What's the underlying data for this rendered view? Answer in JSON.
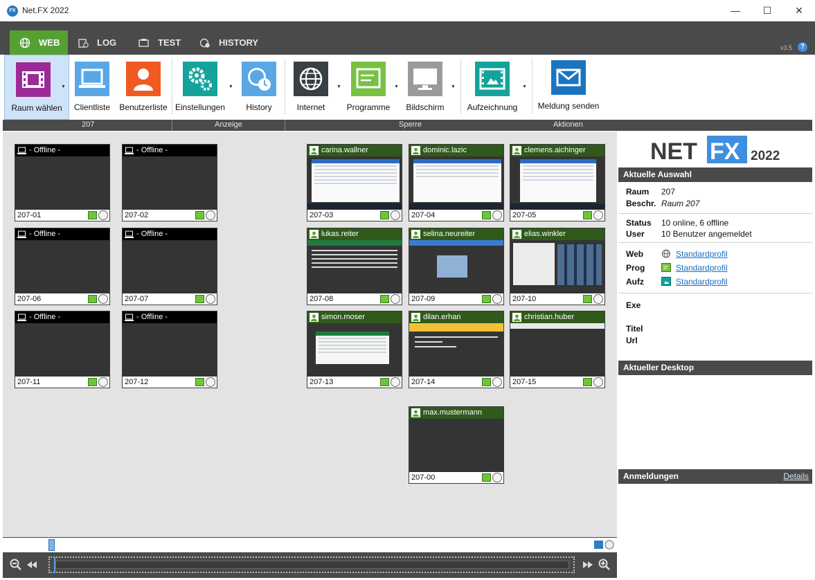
{
  "window": {
    "title": "Net.FX 2022",
    "app_icon": "FX",
    "minimize": "—",
    "maximize": "☐",
    "close": "✕"
  },
  "tabs": [
    {
      "label": "WEB",
      "icon": "globe-icon",
      "active": true
    },
    {
      "label": "LOG",
      "icon": "log-icon",
      "active": false
    },
    {
      "label": "TEST",
      "icon": "test-icon",
      "active": false
    },
    {
      "label": "HISTORY",
      "icon": "history-icon",
      "active": false
    }
  ],
  "version": "v3.5",
  "help": "?",
  "ribbon": {
    "buttons": [
      {
        "label": "Raum wählen",
        "icon": "film-strip-icon",
        "color": "#9b2a98",
        "dropdown": true,
        "selected": true
      },
      {
        "label": "Clientliste",
        "icon": "laptop-icon",
        "color": "#5aa7e6",
        "dropdown": false
      },
      {
        "label": "Benutzerliste",
        "icon": "user-icon",
        "color": "#f0591f",
        "dropdown": false
      },
      {
        "label": "Einstellungen",
        "icon": "gears-icon",
        "color": "#13a39b",
        "dropdown": true
      },
      {
        "label": "History",
        "icon": "clock-globe-icon",
        "color": "#5aa7e6",
        "dropdown": false
      },
      {
        "label": "Internet",
        "icon": "globe-icon",
        "color": "#3a3f43",
        "dropdown": true
      },
      {
        "label": "Programme",
        "icon": "program-icon",
        "color": "#79c142",
        "dropdown": true
      },
      {
        "label": "Bildschirm",
        "icon": "monitor-icon",
        "color": "#9a9a9a",
        "dropdown": true
      },
      {
        "label": "Aufzeichnung",
        "icon": "recording-icon",
        "color": "#13a39b",
        "dropdown": true
      },
      {
        "label": "Meldung senden",
        "icon": "envelope-icon",
        "color": "#1b74c0",
        "dropdown": false
      }
    ],
    "groups": {
      "room": "207",
      "view": "Anzeige",
      "lock": "Sperre",
      "actions": "Aktionen"
    }
  },
  "clients": [
    {
      "id": "207-01",
      "user": " - Offline -",
      "online": false
    },
    {
      "id": "207-02",
      "user": " - Offline -",
      "online": false
    },
    {
      "id": "207-06",
      "user": " - Offline -",
      "online": false
    },
    {
      "id": "207-07",
      "user": " - Offline -",
      "online": false
    },
    {
      "id": "207-11",
      "user": " - Offline -",
      "online": false
    },
    {
      "id": "207-12",
      "user": " - Offline -",
      "online": false
    },
    {
      "id": "207-03",
      "user": "carina.wallner",
      "online": true
    },
    {
      "id": "207-04",
      "user": "dominic.lazic",
      "online": true
    },
    {
      "id": "207-05",
      "user": "clemens.aichinger",
      "online": true
    },
    {
      "id": "207-08",
      "user": "lukas.reiter",
      "online": true
    },
    {
      "id": "207-09",
      "user": "selina.neureiter",
      "online": true
    },
    {
      "id": "207-10",
      "user": "elias.winkler",
      "online": true
    },
    {
      "id": "207-13",
      "user": "simon.moser",
      "online": true
    },
    {
      "id": "207-14",
      "user": "dilan.erhan",
      "online": true
    },
    {
      "id": "207-15",
      "user": "christian.huber",
      "online": true
    },
    {
      "id": "207-00",
      "user": "max.mustermann",
      "online": true
    }
  ],
  "panel": {
    "logo": {
      "left": "NET",
      "right": "FX",
      "year": "2022"
    },
    "selection": {
      "header": "Aktuelle Auswahl",
      "raum_key": "Raum",
      "raum_val": "207",
      "beschr_key": "Beschr.",
      "beschr_val": "Raum 207",
      "status_key": "Status",
      "status_val": "10 online, 6 offline",
      "user_key": "User",
      "user_val": "10 Benutzer angemeldet",
      "web_key": "Web",
      "prog_key": "Prog",
      "aufz_key": "Aufz",
      "profile": "Standardprofil",
      "exe_key": "Exe",
      "titel_key": "Titel",
      "url_key": "Url"
    },
    "desktop": {
      "header": "Aktueller Desktop"
    },
    "logins": {
      "header": "Anmeldungen",
      "details": "Details"
    }
  },
  "player": {
    "zoom_out": "zoom-out-icon",
    "rewind": "rewind-icon",
    "forward": "fast-forward-icon",
    "zoom_in": "zoom-in-icon"
  }
}
